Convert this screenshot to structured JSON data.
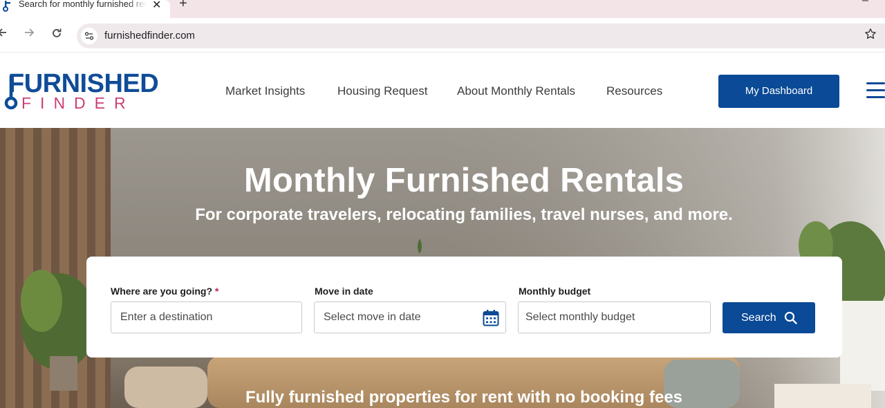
{
  "browser": {
    "tab_title": "Search for monthly furnished rentals",
    "tab_close_glyph": "✕",
    "new_tab_glyph": "+",
    "minimize_glyph": "–",
    "url": "furnishedfinder.com",
    "icons": [
      "back-arrow-icon",
      "forward-arrow-icon",
      "reload-icon",
      "site-info-icon",
      "bookmark-star-icon",
      "close-icon"
    ]
  },
  "header": {
    "logo_top": "FURNISHED",
    "logo_bottom": "FINDER",
    "nav": [
      "Market Insights",
      "Housing Request",
      "About Monthly Rentals",
      "Resources"
    ],
    "dashboard_label": "My Dashboard",
    "colors": {
      "brand_blue": "#0a4a96",
      "brand_pink": "#cc3f76"
    }
  },
  "hero": {
    "title": "Monthly Furnished Rentals",
    "subtitle": "For corporate travelers, relocating families, travel nurses, and more.",
    "footer_text": "Fully furnished properties for rent with no booking fees"
  },
  "search": {
    "destination_label": "Where are you going?",
    "destination_required_mark": "*",
    "destination_placeholder": "Enter a destination",
    "move_in_label": "Move in date",
    "move_in_placeholder": "Select move in date",
    "budget_label": "Monthly budget",
    "budget_placeholder": "Select monthly budget",
    "button_label": "Search"
  }
}
